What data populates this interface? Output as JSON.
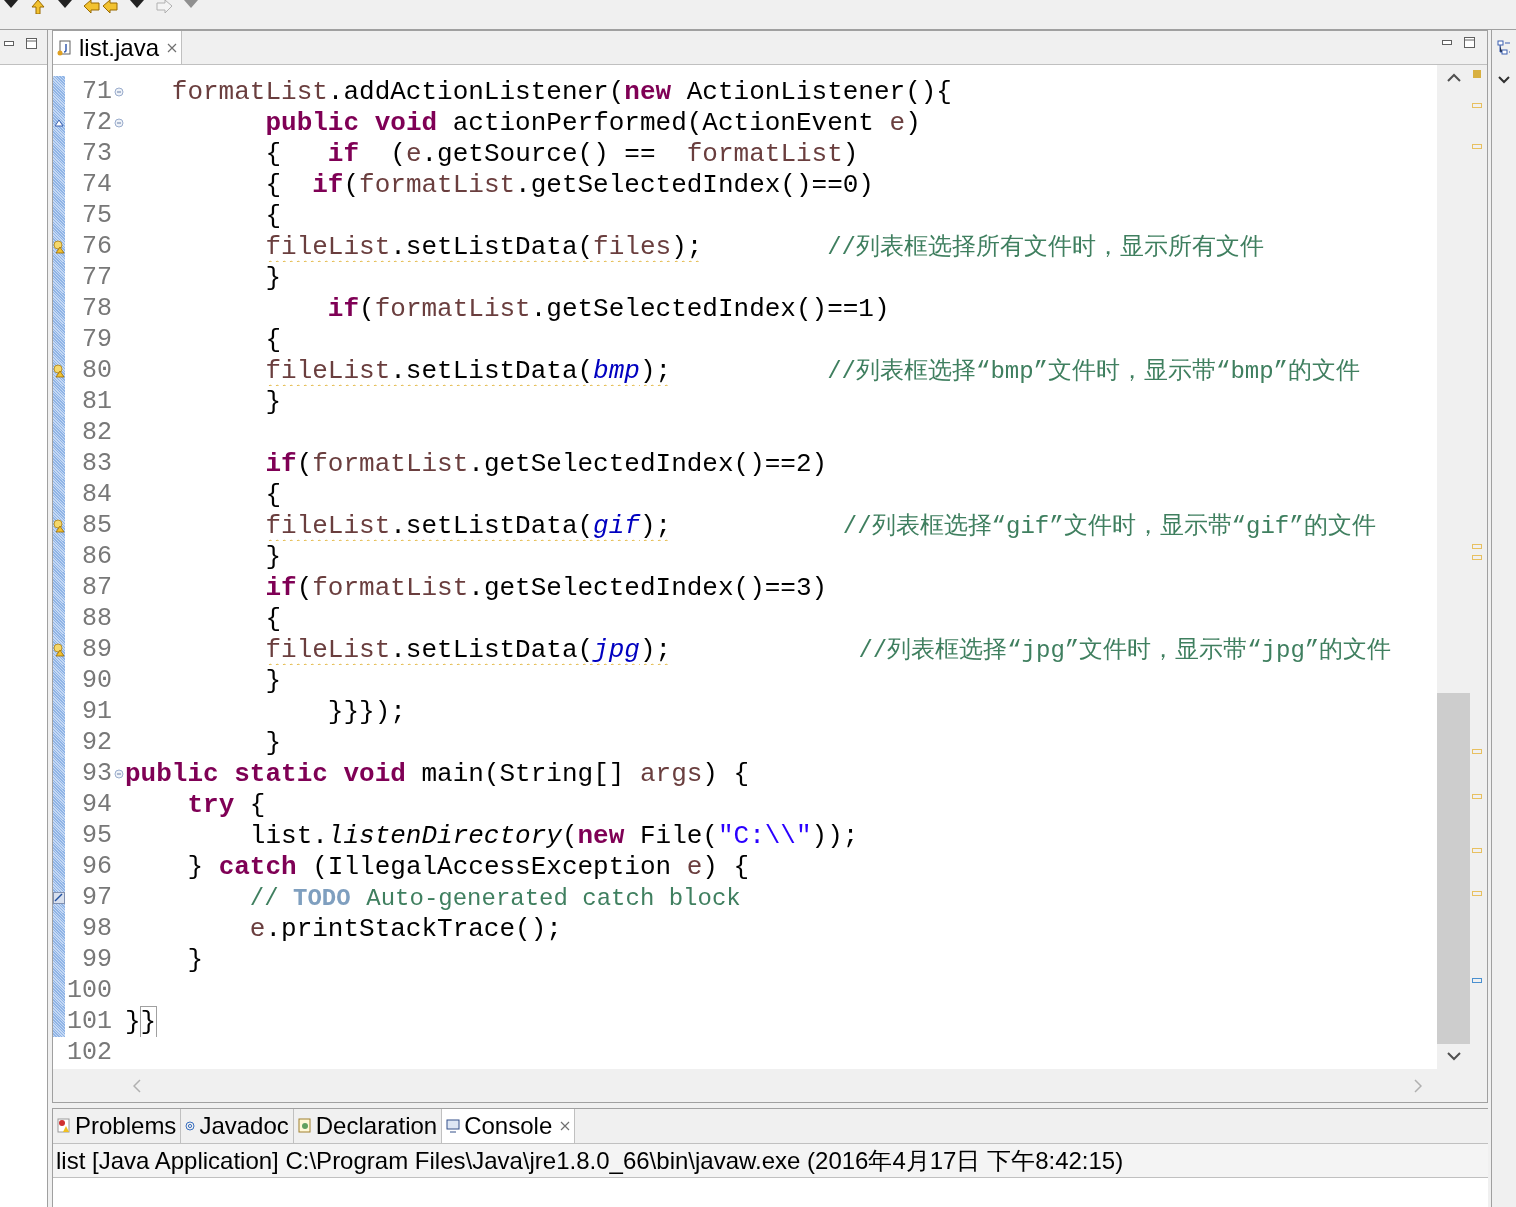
{
  "editor": {
    "tab": {
      "label": "list.java",
      "selected": true
    },
    "lines": [
      {
        "number": "71",
        "changed": true,
        "fold": true,
        "kind": "plain",
        "tokens": [
          {
            "kind": "var",
            "text": "   formatList"
          },
          {
            "kind": "plain",
            "text": ".addActionListener("
          },
          {
            "kind": "kw",
            "text": "new"
          },
          {
            "kind": "plain",
            "text": " ActionListener(){"
          }
        ]
      },
      {
        "number": "72",
        "changed": true,
        "fold": true,
        "kind": "override",
        "tokens": [
          {
            "kind": "kw",
            "text": "         public"
          },
          {
            "kind": "kw",
            "text": " void"
          },
          {
            "kind": "plain",
            "text": " actionPerformed(ActionEvent "
          },
          {
            "kind": "var",
            "text": "e"
          },
          {
            "kind": "plain",
            "text": ")"
          }
        ]
      },
      {
        "number": "73",
        "changed": true,
        "fold": false,
        "kind": "plain",
        "tokens": [
          {
            "kind": "plain",
            "text": "         {   "
          },
          {
            "kind": "kw",
            "text": "if"
          },
          {
            "kind": "plain",
            "text": "  ("
          },
          {
            "kind": "var",
            "text": "e"
          },
          {
            "kind": "plain",
            "text": ".getSource() ==  "
          },
          {
            "kind": "var",
            "text": "formatList"
          },
          {
            "kind": "plain",
            "text": ")"
          }
        ]
      },
      {
        "number": "74",
        "changed": true,
        "fold": false,
        "kind": "plain",
        "tokens": [
          {
            "kind": "plain",
            "text": "         {  "
          },
          {
            "kind": "kw",
            "text": "if"
          },
          {
            "kind": "plain",
            "text": "("
          },
          {
            "kind": "var",
            "text": "formatList"
          },
          {
            "kind": "plain",
            "text": ".getSelectedIndex()==0)"
          }
        ]
      },
      {
        "number": "75",
        "changed": true,
        "fold": false,
        "kind": "plain",
        "tokens": [
          {
            "kind": "plain",
            "text": "         {"
          }
        ]
      },
      {
        "number": "76",
        "changed": true,
        "fold": false,
        "kind": "warning",
        "tokens": [
          {
            "kind": "squiggle",
            "tokens": [
              {
                "kind": "var",
                "text": "         fileList"
              },
              {
                "kind": "plain",
                "text": ".setListData("
              },
              {
                "kind": "var",
                "text": "files"
              },
              {
                "kind": "plain",
                "text": ");"
              }
            ]
          },
          {
            "kind": "comment",
            "text": "        //列表框选择所有文件时，显示所有文件"
          }
        ]
      },
      {
        "number": "77",
        "changed": true,
        "fold": false,
        "kind": "plain",
        "tokens": [
          {
            "kind": "plain",
            "text": "         }"
          }
        ]
      },
      {
        "number": "78",
        "changed": true,
        "fold": false,
        "kind": "plain",
        "tokens": [
          {
            "kind": "kw",
            "text": "             if"
          },
          {
            "kind": "plain",
            "text": "("
          },
          {
            "kind": "var",
            "text": "formatList"
          },
          {
            "kind": "plain",
            "text": ".getSelectedIndex()==1)"
          }
        ]
      },
      {
        "number": "79",
        "changed": true,
        "fold": false,
        "kind": "plain",
        "tokens": [
          {
            "kind": "plain",
            "text": "         {"
          }
        ]
      },
      {
        "number": "80",
        "changed": true,
        "fold": false,
        "kind": "warning",
        "tokens": [
          {
            "kind": "squiggle",
            "tokens": [
              {
                "kind": "var",
                "text": "         fileList"
              },
              {
                "kind": "plain",
                "text": ".setListData("
              },
              {
                "kind": "sfield",
                "text": "bmp"
              },
              {
                "kind": "plain",
                "text": ");"
              }
            ]
          },
          {
            "kind": "comment",
            "text": "          //列表框选择“bmp”文件时，显示带“bmp”的文件"
          }
        ]
      },
      {
        "number": "81",
        "changed": true,
        "fold": false,
        "kind": "plain",
        "tokens": [
          {
            "kind": "plain",
            "text": "         }"
          }
        ]
      },
      {
        "number": "82",
        "changed": true,
        "fold": false,
        "kind": "plain"
      },
      {
        "number": "83",
        "changed": true,
        "fold": false,
        "kind": "plain",
        "tokens": [
          {
            "kind": "kw",
            "text": "         if"
          },
          {
            "kind": "plain",
            "text": "("
          },
          {
            "kind": "var",
            "text": "formatList"
          },
          {
            "kind": "plain",
            "text": ".getSelectedIndex()==2)"
          }
        ]
      },
      {
        "number": "84",
        "changed": true,
        "fold": false,
        "kind": "plain",
        "tokens": [
          {
            "kind": "plain",
            "text": "         {"
          }
        ]
      },
      {
        "number": "85",
        "changed": true,
        "fold": false,
        "kind": "warning",
        "tokens": [
          {
            "kind": "squiggle",
            "tokens": [
              {
                "kind": "var",
                "text": "         fileList"
              },
              {
                "kind": "plain",
                "text": ".setListData("
              },
              {
                "kind": "sfield",
                "text": "gif"
              },
              {
                "kind": "plain",
                "text": ");"
              }
            ]
          },
          {
            "kind": "comment",
            "text": "           //列表框选择“gif”文件时，显示带“gif”的文件"
          }
        ]
      },
      {
        "number": "86",
        "changed": true,
        "fold": false,
        "kind": "plain",
        "tokens": [
          {
            "kind": "plain",
            "text": "         }"
          }
        ]
      },
      {
        "number": "87",
        "changed": true,
        "fold": false,
        "kind": "plain",
        "tokens": [
          {
            "kind": "kw",
            "text": "         if"
          },
          {
            "kind": "plain",
            "text": "("
          },
          {
            "kind": "var",
            "text": "formatList"
          },
          {
            "kind": "plain",
            "text": ".getSelectedIndex()==3)"
          }
        ]
      },
      {
        "number": "88",
        "changed": true,
        "fold": false,
        "kind": "plain",
        "tokens": [
          {
            "kind": "plain",
            "text": "         {"
          }
        ]
      },
      {
        "number": "89",
        "changed": true,
        "fold": false,
        "kind": "warning",
        "tokens": [
          {
            "kind": "squiggle",
            "tokens": [
              {
                "kind": "var",
                "text": "         fileList"
              },
              {
                "kind": "plain",
                "text": ".setListData("
              },
              {
                "kind": "sfield",
                "text": "jpg"
              },
              {
                "kind": "plain",
                "text": ");"
              }
            ]
          },
          {
            "kind": "comment",
            "text": "            //列表框选择“jpg”文件时，显示带“jpg”的文件"
          }
        ]
      },
      {
        "number": "90",
        "changed": true,
        "fold": false,
        "kind": "plain",
        "tokens": [
          {
            "kind": "plain",
            "text": "         }"
          }
        ]
      },
      {
        "number": "91",
        "changed": true,
        "fold": false,
        "kind": "plain",
        "tokens": [
          {
            "kind": "plain",
            "text": "             }}});"
          }
        ]
      },
      {
        "number": "92",
        "changed": true,
        "fold": false,
        "kind": "plain",
        "tokens": [
          {
            "kind": "plain",
            "text": "         }"
          }
        ]
      },
      {
        "number": "93",
        "changed": true,
        "fold": true,
        "kind": "plain",
        "tokens": [
          {
            "kind": "kw",
            "text": "public"
          },
          {
            "kind": "kw",
            "text": " static"
          },
          {
            "kind": "kw",
            "text": " void"
          },
          {
            "kind": "plain",
            "text": " main(String[] "
          },
          {
            "kind": "var",
            "text": "args"
          },
          {
            "kind": "plain",
            "text": ") {"
          }
        ]
      },
      {
        "number": "94",
        "changed": true,
        "fold": false,
        "kind": "plain",
        "tokens": [
          {
            "kind": "kw",
            "text": "    try"
          },
          {
            "kind": "plain",
            "text": " {"
          }
        ]
      },
      {
        "number": "95",
        "changed": true,
        "fold": false,
        "kind": "plain",
        "tokens": [
          {
            "kind": "plain",
            "text": "        list."
          },
          {
            "kind": "smethod",
            "text": "listenDirectory"
          },
          {
            "kind": "plain",
            "text": "("
          },
          {
            "kind": "kw",
            "text": "new"
          },
          {
            "kind": "plain",
            "text": " File("
          },
          {
            "kind": "string",
            "text": "\"C:\\\\\""
          },
          {
            "kind": "plain",
            "text": "));"
          }
        ]
      },
      {
        "number": "96",
        "changed": true,
        "fold": false,
        "kind": "plain",
        "tokens": [
          {
            "kind": "plain",
            "text": "    }"
          },
          {
            "kind": "kw",
            "text": " catch"
          },
          {
            "kind": "plain",
            "text": " (IllegalAccessException "
          },
          {
            "kind": "var",
            "text": "e"
          },
          {
            "kind": "plain",
            "text": ") {"
          }
        ]
      },
      {
        "number": "97",
        "changed": true,
        "fold": false,
        "kind": "task",
        "tokens": [
          {
            "kind": "comment",
            "text": "        // "
          },
          {
            "kind": "todo",
            "text": "TODO"
          },
          {
            "kind": "comment",
            "text": " Auto-generated catch block"
          }
        ]
      },
      {
        "number": "98",
        "changed": true,
        "fold": false,
        "kind": "plain",
        "tokens": [
          {
            "kind": "var",
            "text": "        e"
          },
          {
            "kind": "plain",
            "text": ".printStackTrace();"
          }
        ]
      },
      {
        "number": "99",
        "changed": true,
        "fold": false,
        "kind": "plain",
        "tokens": [
          {
            "kind": "plain",
            "text": "    }"
          }
        ]
      },
      {
        "number": "100",
        "changed": true,
        "fold": false,
        "kind": "plain"
      },
      {
        "number": "101",
        "changed": true,
        "fold": false,
        "kind": "plain",
        "tokens": [
          {
            "kind": "plain",
            "text": "}"
          },
          {
            "kind": "match",
            "text": "}"
          }
        ]
      },
      {
        "number": "102",
        "changed": false,
        "fold": false,
        "kind": "plain"
      }
    ]
  },
  "bottom_tabs": [
    {
      "label": "Problems",
      "selected": false
    },
    {
      "label": "Javadoc",
      "selected": false
    },
    {
      "label": "Declaration",
      "selected": false
    },
    {
      "label": "Console",
      "selected": true
    }
  ],
  "console": {
    "header": "list [Java Application] C:\\Program Files\\Java\\jre1.8.0_66\\bin\\javaw.exe (2016年4月17日 下午8:42:15)"
  }
}
